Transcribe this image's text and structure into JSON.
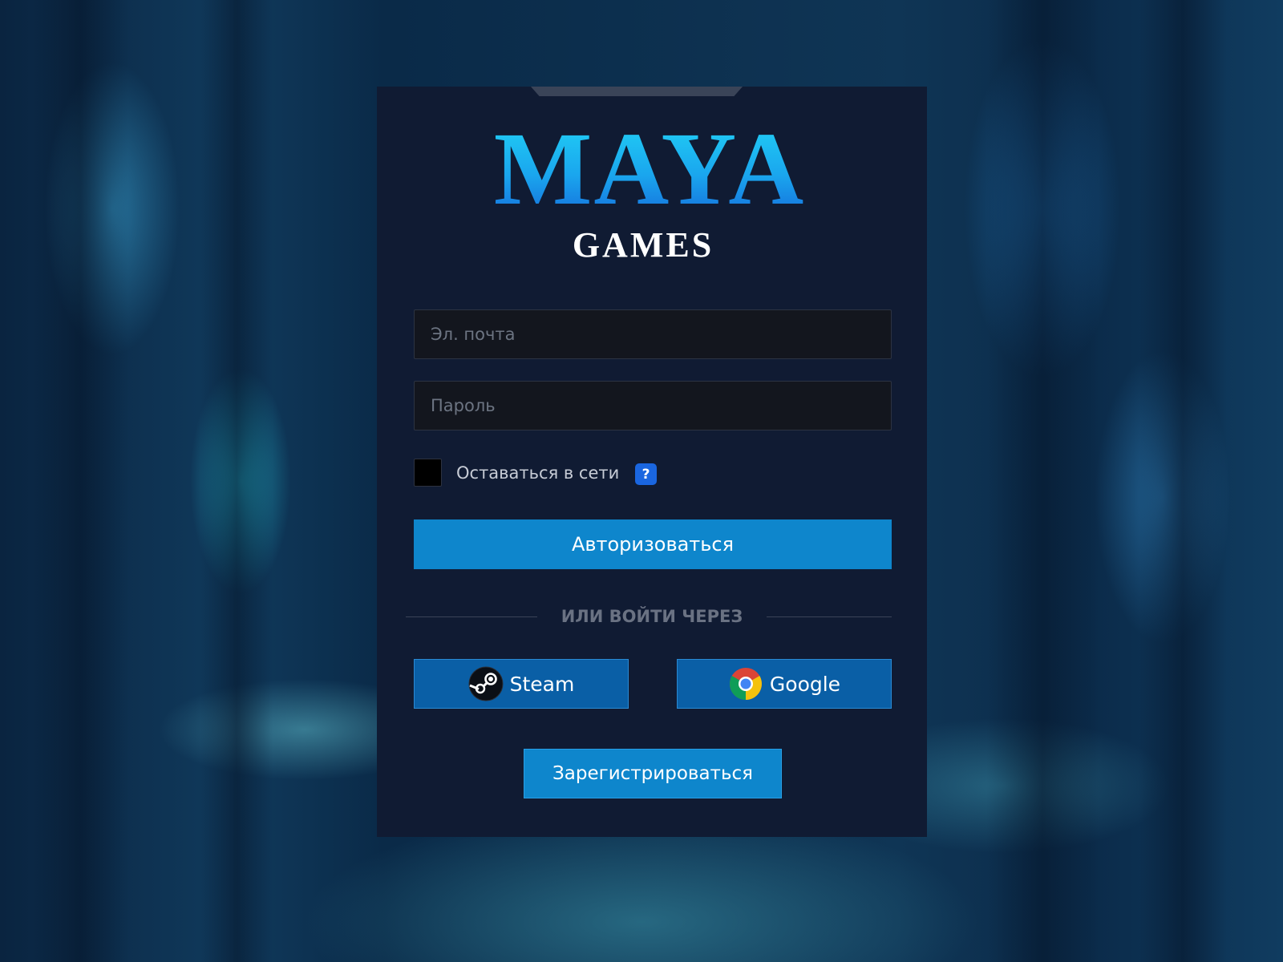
{
  "brand": {
    "logo_main": "MAYA",
    "logo_sub": "GAMES"
  },
  "form": {
    "email_placeholder": "Эл. почта",
    "password_placeholder": "Пароль",
    "remember_label": "Оставаться в сети",
    "help_glyph": "?",
    "login_label": "Авторизоваться",
    "divider_text": "ИЛИ ВОЙТИ ЧЕРЕЗ",
    "steam_label": "Steam",
    "google_label": "Google",
    "register_label": "Зарегистрироваться"
  },
  "colors": {
    "card_bg": "#101b33",
    "primary_button": "#0e86cc",
    "social_button": "#0a5fa6",
    "help_badge": "#1a66e0"
  },
  "icons": {
    "steam": "steam-icon",
    "google": "chrome-icon",
    "help": "question-icon"
  }
}
